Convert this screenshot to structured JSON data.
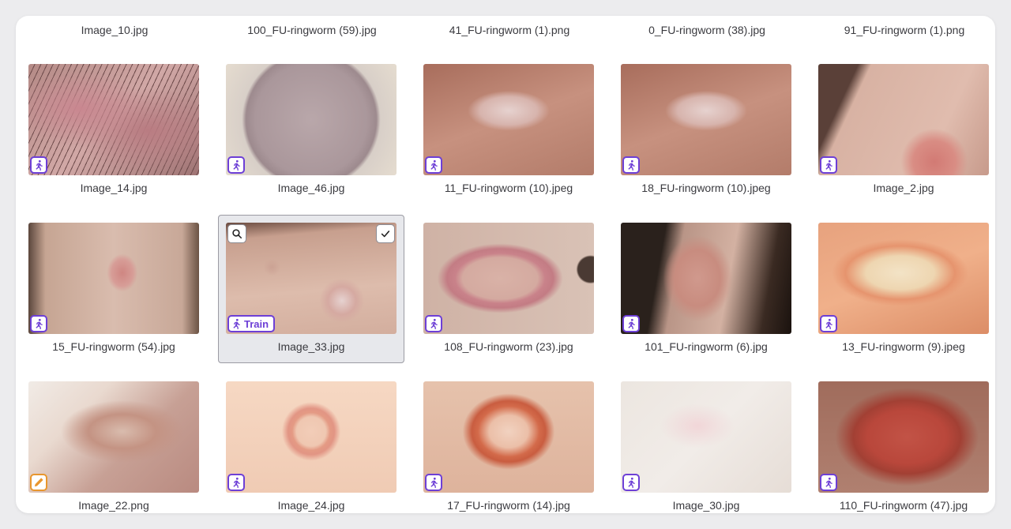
{
  "top_row": [
    "Image_10.jpg",
    "100_FU-ringworm (59).jpg",
    "41_FU-ringworm (1).png",
    "0_FU-ringworm (38).jpg",
    "91_FU-ringworm (1).png"
  ],
  "cards": [
    {
      "name": "Image_14.jpg",
      "badge": "train"
    },
    {
      "name": "Image_46.jpg",
      "badge": "train"
    },
    {
      "name": "11_FU-ringworm (10).jpeg",
      "badge": "train"
    },
    {
      "name": "18_FU-ringworm (10).jpeg",
      "badge": "train"
    },
    {
      "name": "Image_2.jpg",
      "badge": "train"
    },
    {
      "name": "15_FU-ringworm (54).jpg",
      "badge": "train"
    },
    {
      "name": "Image_33.jpg",
      "badge": "train",
      "badge_label": "Train",
      "selected": true
    },
    {
      "name": "108_FU-ringworm (23).jpg",
      "badge": "train"
    },
    {
      "name": "101_FU-ringworm (6).jpg",
      "badge": "train"
    },
    {
      "name": "13_FU-ringworm (9).jpeg",
      "badge": "train"
    },
    {
      "name": "Image_22.png",
      "badge": "annotate"
    },
    {
      "name": "Image_24.jpg",
      "badge": "train"
    },
    {
      "name": "17_FU-ringworm (14).jpg",
      "badge": "train"
    },
    {
      "name": "Image_30.jpg",
      "badge": "train"
    },
    {
      "name": "110_FU-ringworm (47).jpg",
      "badge": "train"
    }
  ],
  "icons": {
    "train": "runner-icon",
    "annotate": "pencil-icon",
    "zoom": "magnifier-icon",
    "select": "check-icon"
  },
  "colors": {
    "train_accent": "#6d3fd6",
    "annotate_accent": "#e8962e",
    "selected_bg": "#e7e8ec"
  }
}
